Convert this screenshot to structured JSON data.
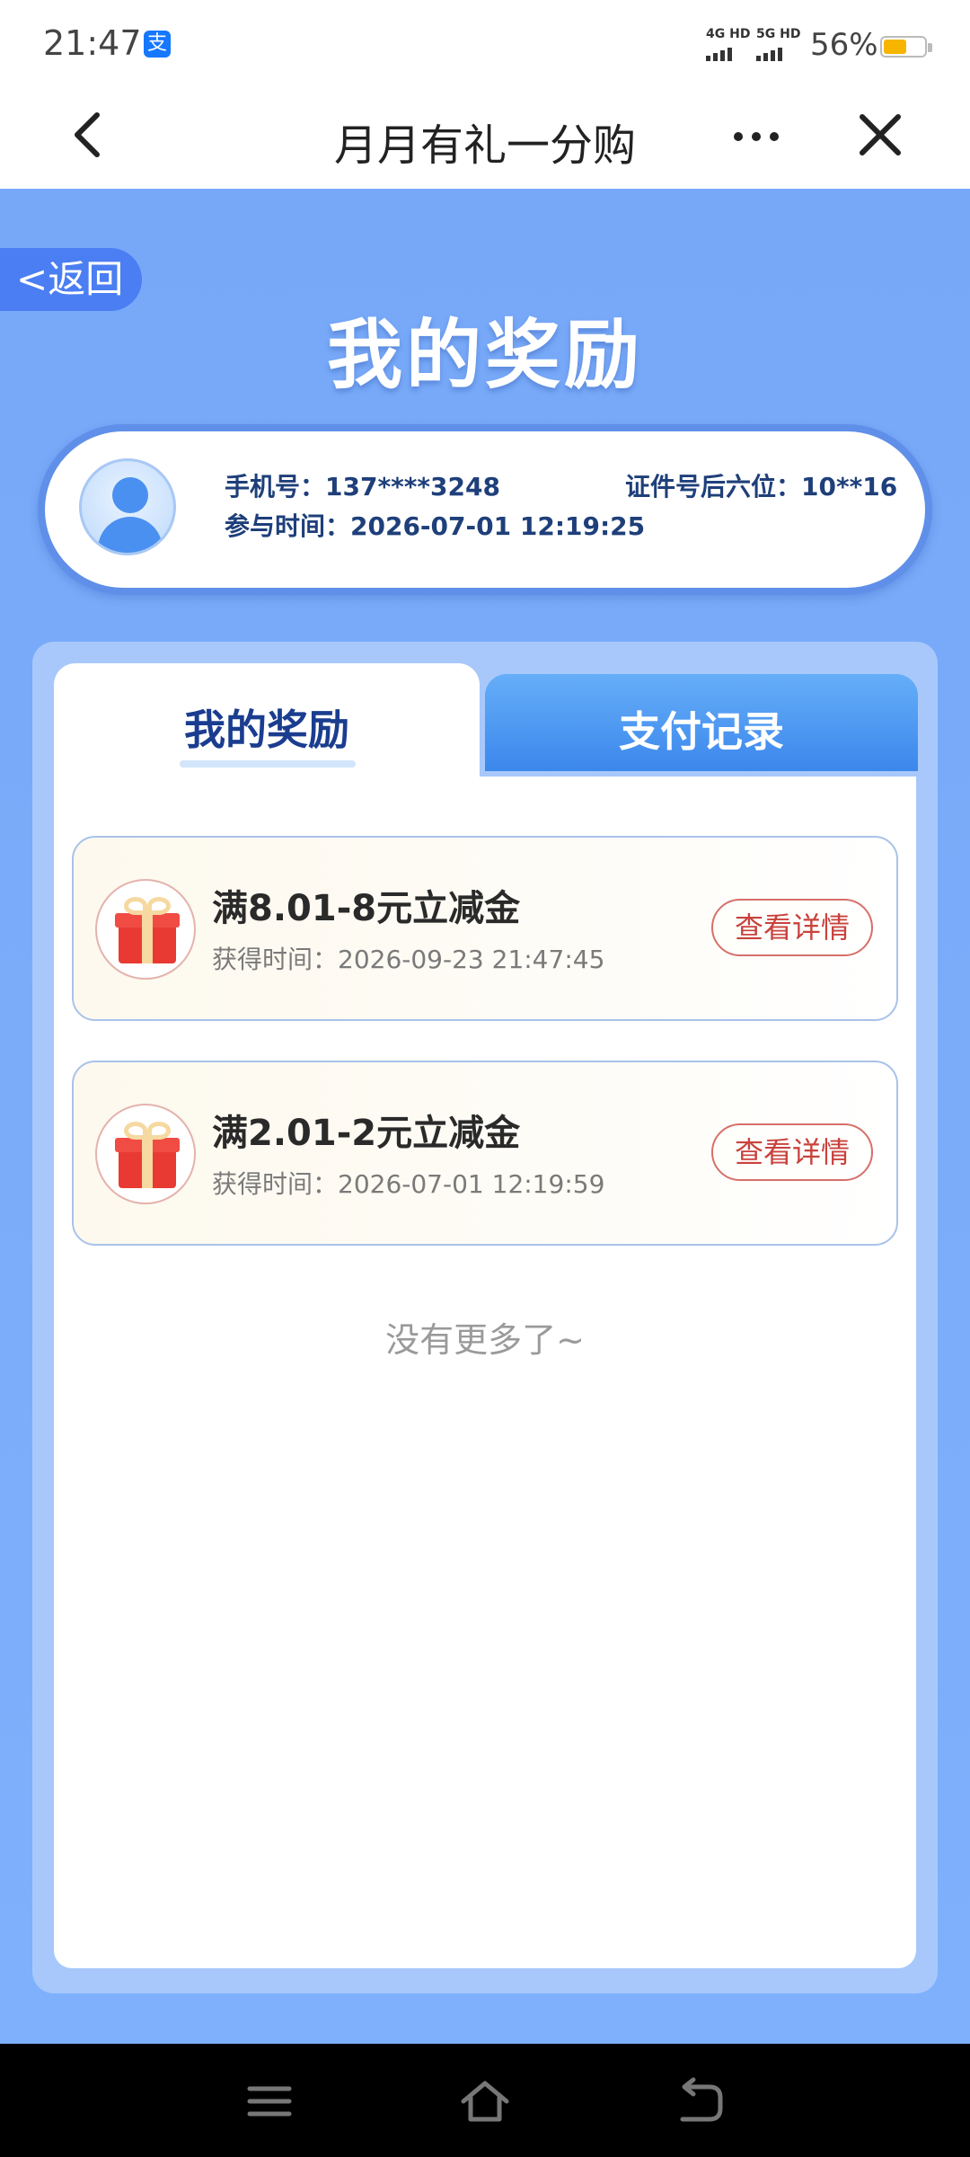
{
  "status_bar": {
    "time": "21:47",
    "app_badge_icon": "alipay-icon",
    "app_badge_char": "支",
    "network_1": "4G HD",
    "network_2": "5G HD",
    "battery_percent": "56%",
    "battery_level": 0.56,
    "battery_color": "#f7b500"
  },
  "nav_bar": {
    "back_icon": "chevron-left-icon",
    "title": "月月有礼一分购",
    "more_icon": "more-dots-icon",
    "close_icon": "close-icon"
  },
  "page": {
    "return_label": "<返回",
    "title": "我的奖励",
    "accent_color": "#4a7ef2"
  },
  "user_card": {
    "avatar_icon": "user-avatar-icon",
    "phone": "手机号：137****3248",
    "id_suffix": "证件号后六位：10**16",
    "join_time": "参与时间：2026-07-01 12:19:25"
  },
  "tabs": [
    {
      "label": "我的奖励",
      "active": true
    },
    {
      "label": "支付记录",
      "active": false
    }
  ],
  "rewards": [
    {
      "icon": "gift-icon",
      "title": "满8.01-8元立减金",
      "time": "获得时间：2026-09-23 21:47:45",
      "button": "查看详情"
    },
    {
      "icon": "gift-icon",
      "title": "满2.01-2元立减金",
      "time": "获得时间：2026-07-01 12:19:59",
      "button": "查看详情"
    }
  ],
  "list_end": "没有更多了~",
  "system_nav": {
    "menu_icon": "menu-icon",
    "home_icon": "home-icon",
    "back_icon": "back-arrow-icon"
  }
}
